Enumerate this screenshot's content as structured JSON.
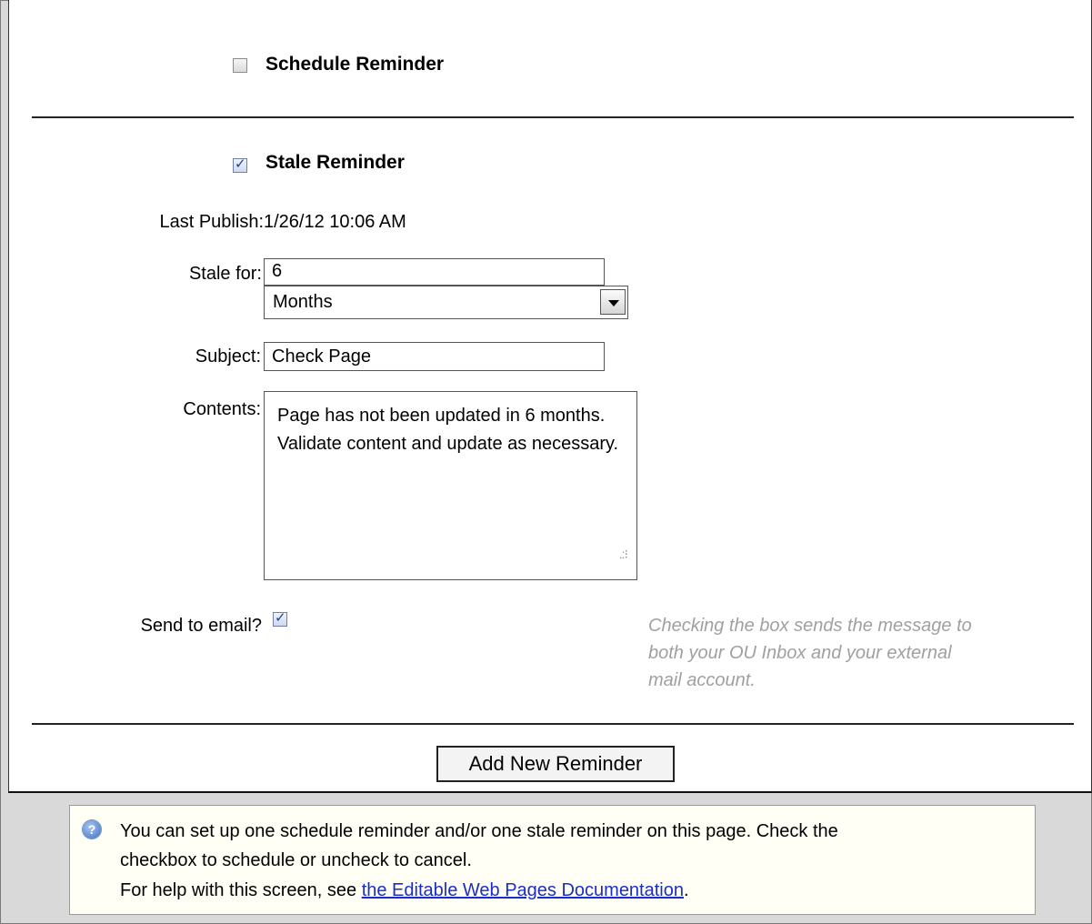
{
  "schedule_reminder": {
    "label": "Schedule Reminder",
    "checked": false
  },
  "stale_reminder": {
    "label": "Stale Reminder",
    "checked": true
  },
  "last_publish": {
    "label": "Last Publish:",
    "value": "1/26/12 10:06 AM"
  },
  "stale_for": {
    "label": "Stale for:",
    "value": "6",
    "unit": "Months"
  },
  "subject": {
    "label": "Subject:",
    "value": "Check Page"
  },
  "contents": {
    "label": "Contents:",
    "value": "Page has not been updated in 6 months. Validate content and update as necessary."
  },
  "send_email": {
    "label": "Send to email?",
    "checked": true,
    "hint_lines": [
      "Checking the box sends the message to",
      "both your OU Inbox and your external",
      "mail account."
    ]
  },
  "add_button": {
    "label": "Add New Reminder"
  },
  "info": {
    "line1": "You can set up one schedule reminder and/or one stale reminder on this page. Check the",
    "line2": "checkbox to schedule or uncheck to cancel.",
    "help_prefix": "For help with this screen, see ",
    "help_link": "the Editable Web Pages Documentation",
    "help_suffix": "."
  },
  "icons": {
    "checkbox_check": "✓",
    "info": "?"
  }
}
